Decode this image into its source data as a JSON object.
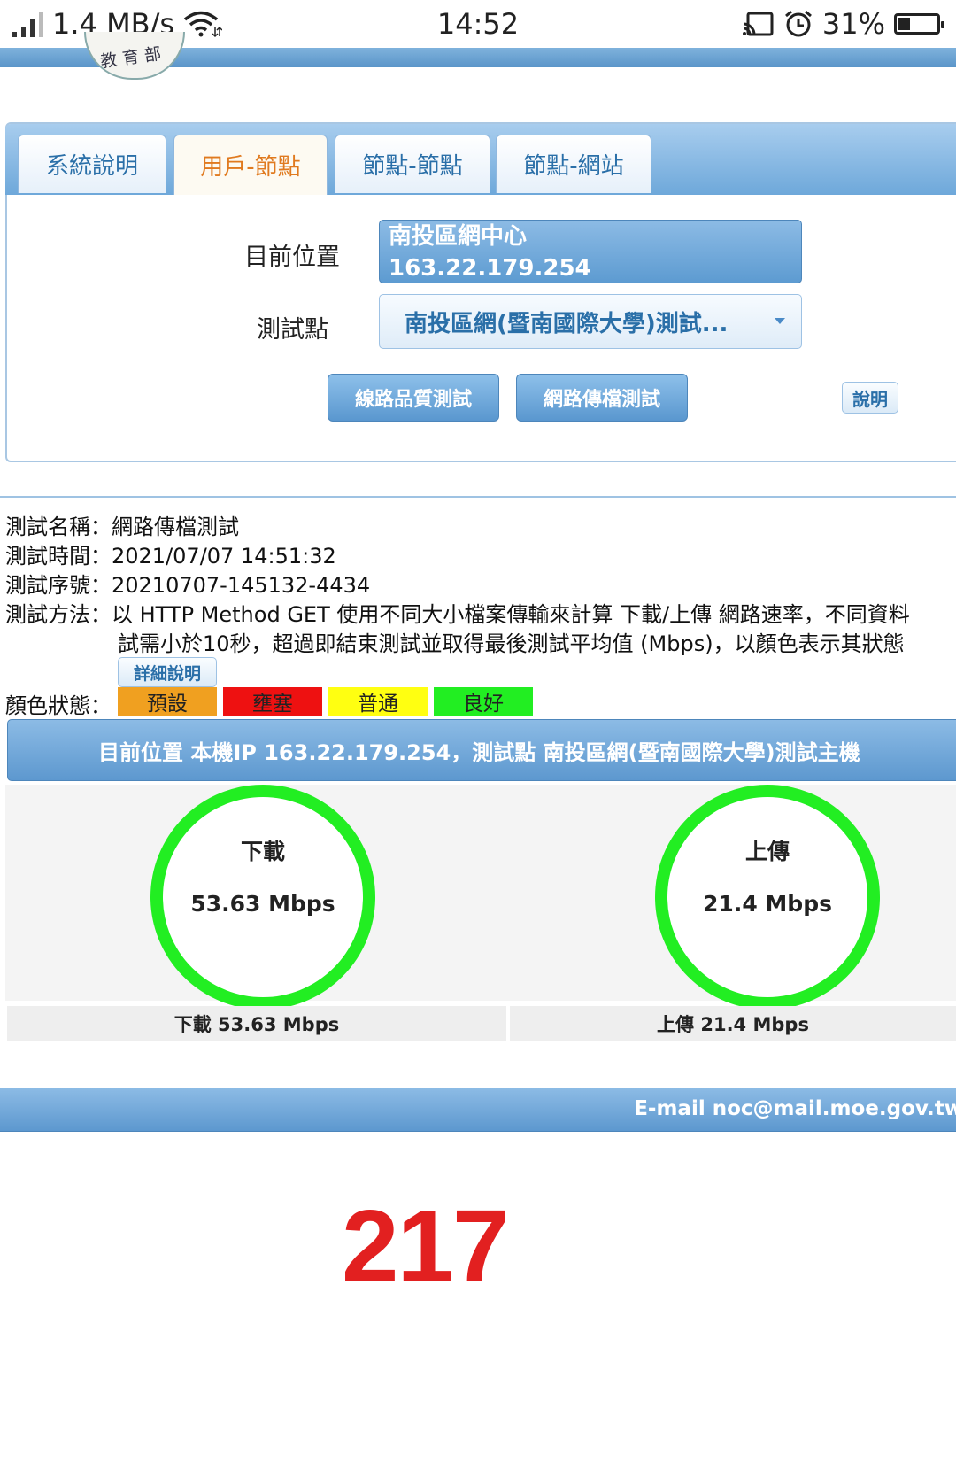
{
  "status_bar": {
    "speed": "1.4 MB/s",
    "time": "14:52",
    "battery": "31%",
    "battery_level": 0.31,
    "icons": [
      "signal-icon",
      "wifi-icon",
      "cast-icon",
      "alarm-icon",
      "battery-icon"
    ]
  },
  "header": {
    "seal_text": "教育部"
  },
  "tabs": [
    {
      "label": "系統說明",
      "active": false
    },
    {
      "label": "用戶-節點",
      "active": true
    },
    {
      "label": "節點-節點",
      "active": false
    },
    {
      "label": "節點-網站",
      "active": false
    }
  ],
  "form": {
    "location_label": "目前位置",
    "location_name": "南投區網中心",
    "location_ip": "163.22.179.254",
    "test_point_label": "測試點",
    "test_point_value": "南投區網(暨南國際大學)測試...",
    "line_quality_button": "線路品質測試",
    "transfer_button": "網路傳檔測試",
    "help_button": "說明"
  },
  "info": {
    "name_label": "測試名稱：",
    "name_value": "網路傳檔測試",
    "time_label": "測試時間：",
    "time_value": "2021/07/07 14:51:32",
    "serial_label": "測試序號：",
    "serial_value": "20210707-145132-4434",
    "method_label": "測試方法：",
    "method_line1": "以 HTTP Method GET 使用不同大小檔案傳輸來計算 下載/上傳 網路速率，不同資料",
    "method_line2": "試需小於10秒，超過即結束測試並取得最後測試平均值 (Mbps)，以顏色表示其狀態",
    "detail_button": "詳細說明",
    "color_label": "顏色狀態：",
    "color_states": [
      {
        "label": "預設",
        "color": "#f0a020"
      },
      {
        "label": "壅塞",
        "color": "#ee1111"
      },
      {
        "label": "普通",
        "color": "#ffff11"
      },
      {
        "label": "良好",
        "color": "#22ee22"
      }
    ]
  },
  "result_bar": "目前位置 本機IP 163.22.179.254，測試點 南投區網(暨南國際大學)測試主機",
  "gauges": {
    "download_label": "下載",
    "download_value": "53.63 Mbps",
    "upload_label": "上傳",
    "upload_value": "21.4 Mbps",
    "download_caption": "下載 53.63 Mbps",
    "upload_caption": "上傳 21.4 Mbps",
    "ring_color": "#22ee22"
  },
  "footer": {
    "email": "E-mail noc@mail.moe.gov.tw"
  },
  "overlay_number": "217"
}
